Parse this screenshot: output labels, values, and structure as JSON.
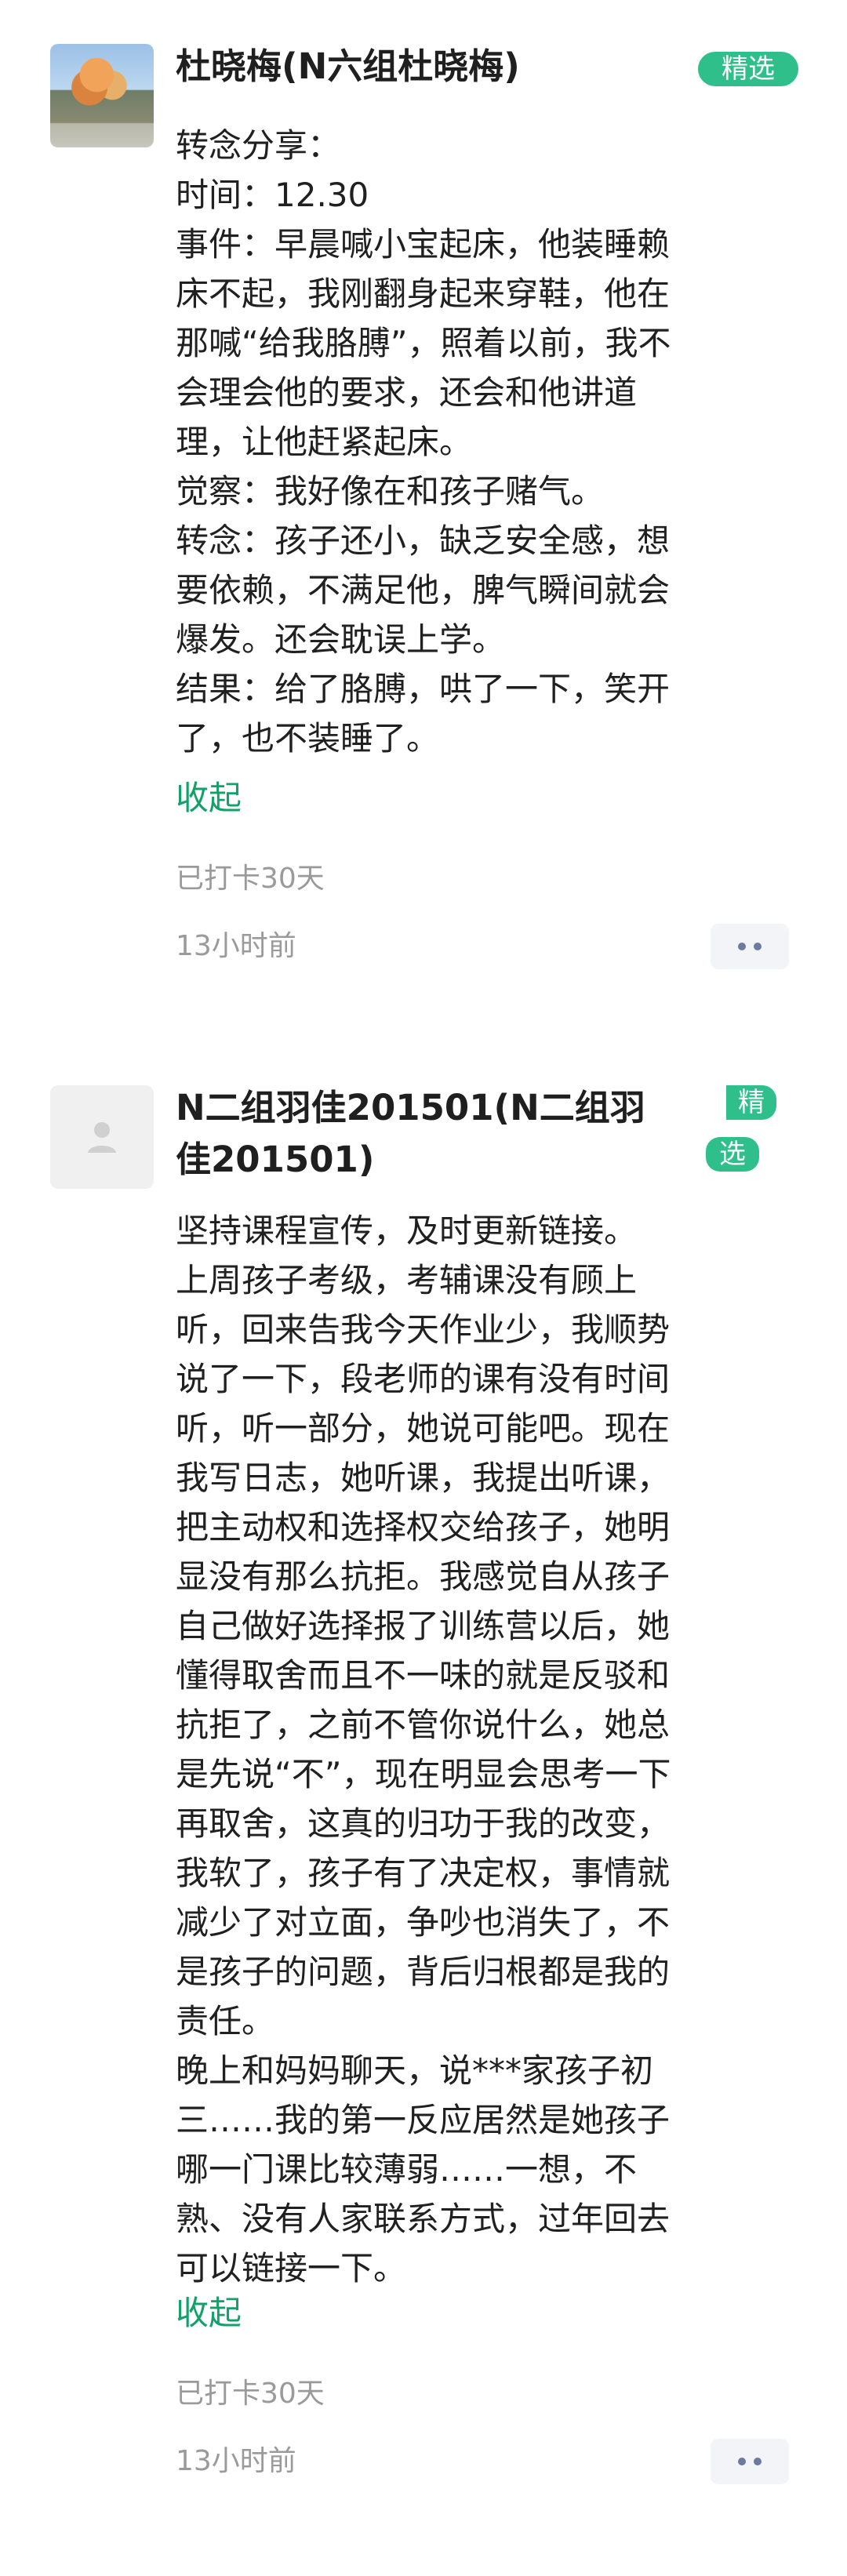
{
  "posts": [
    {
      "author": "杜晓梅(N六组杜晓梅)",
      "badge": "精选",
      "lines": [
        "转念分享：",
        "时间：12.30",
        "事件：早晨喊小宝起床，他装睡赖",
        "床不起，我刚翻身起来穿鞋，他在",
        "那喊“给我胳膊”，照着以前，我不",
        "会理会他的要求，还会和他讲道",
        "理，让他赶紧起床。",
        "觉察：我好像在和孩子赌气。",
        "转念：孩子还小，缺乏安全感，想",
        "要依赖，不满足他，脾气瞬间就会",
        "爆发。还会耽误上学。",
        "结果：给了胳膊，哄了一下，笑开",
        "了，也不装睡了。"
      ],
      "collapse_label": "收起",
      "checkin": "已打卡30天",
      "time": "13小时前"
    },
    {
      "author_line_1": "N二组羽佳201501(N二组羽",
      "author_line_2": "佳201501)",
      "badge_line_1": "精",
      "badge_line_2": "选",
      "lines": [
        "坚持课程宣传，及时更新链接。",
        "上周孩子考级，考辅课没有顾上",
        "听，回来告我今天作业少，我顺势",
        "说了一下，段老师的课有没有时间",
        "听，听一部分，她说可能吧。现在",
        "我写日志，她听课，我提出听课，",
        "把主动权和选择权交给孩子，她明",
        "显没有那么抗拒。我感觉自从孩子",
        "自己做好选择报了训练营以后，她",
        "懂得取舍而且不一味的就是反驳和",
        "抗拒了，之前不管你说什么，她总",
        "是先说“不”，现在明显会思考一下",
        "再取舍，这真的归功于我的改变，",
        "我软了，孩子有了决定权，事情就",
        "减少了对立面，争吵也消失了，不",
        "是孩子的问题，背后归根都是我的",
        "责任。",
        "晚上和妈妈聊天，说***家孩子初",
        "三……我的第一反应居然是她孩子",
        "哪一门课比较薄弱……一想，不",
        "熟、没有人家联系方式，过年回去",
        "可以链接一下。"
      ],
      "collapse_label": "收起",
      "checkin": "已打卡30天",
      "time": "13小时前"
    }
  ],
  "colors": {
    "accent_green": "#14a06a",
    "badge_green": "#2fbf8b",
    "meta_gray": "#9a9a9a",
    "more_dot": "#6b7ba0"
  },
  "icons": {
    "post_1_avatar": "avatar-photo",
    "post_2_avatar": "default-user-icon",
    "more": "more-dots-icon"
  }
}
